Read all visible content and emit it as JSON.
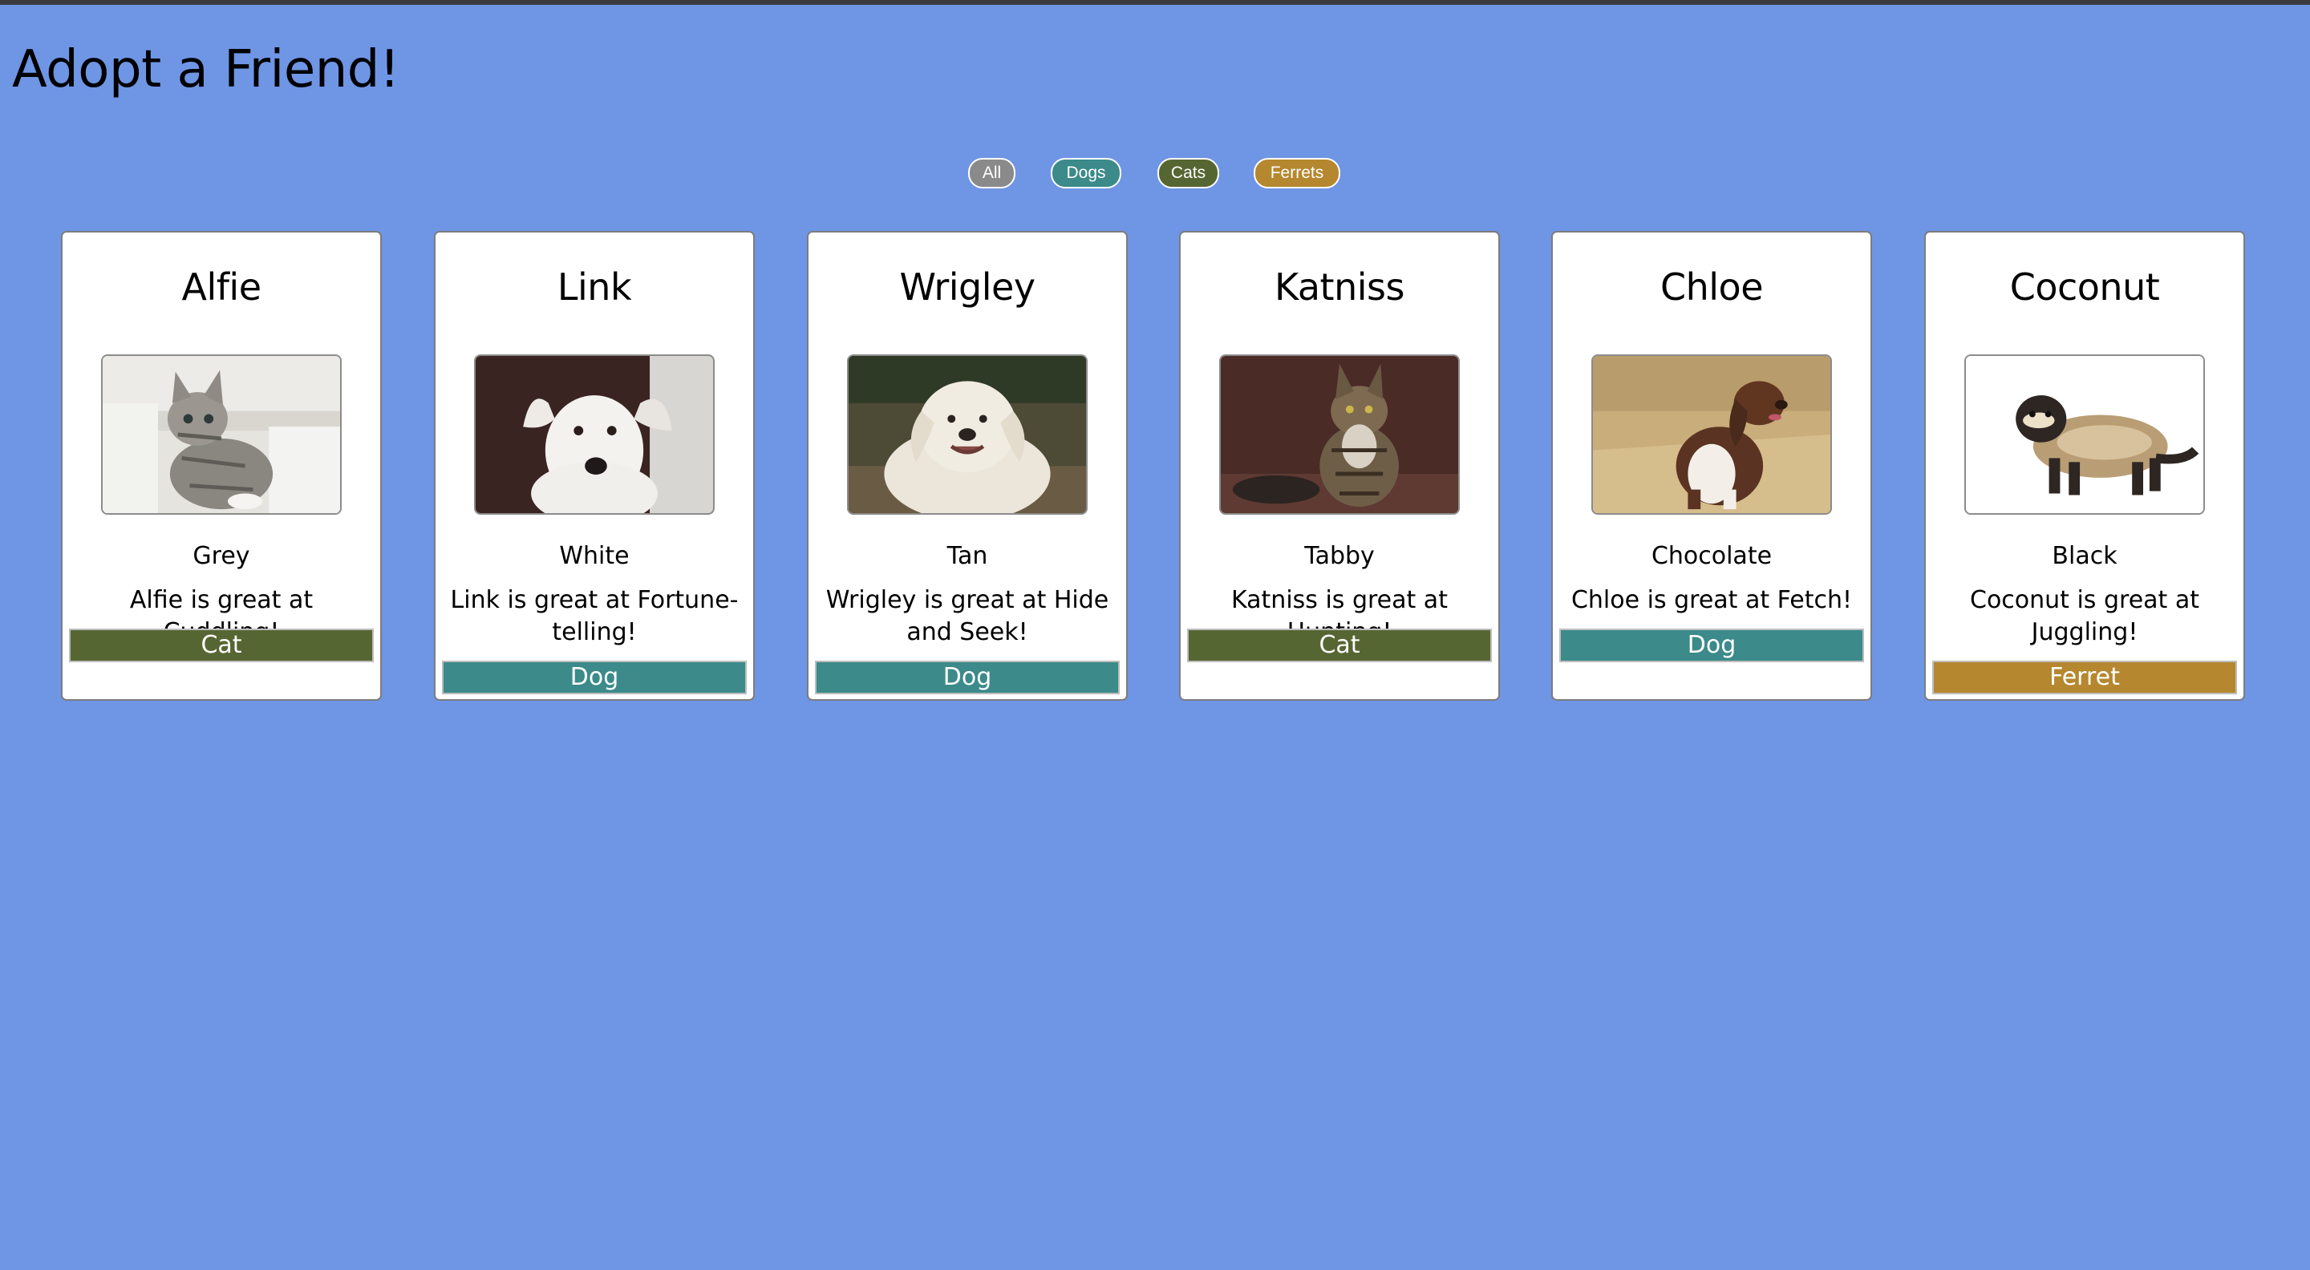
{
  "page": {
    "title": "Adopt a Friend!",
    "background_color": "#6f95e5"
  },
  "filters": [
    {
      "label": "All",
      "color": "#8a8a8a"
    },
    {
      "label": "Dogs",
      "color": "#3c8a8a"
    },
    {
      "label": "Cats",
      "color": "#566632"
    },
    {
      "label": "Ferrets",
      "color": "#b5872f"
    }
  ],
  "pets": [
    {
      "name": "Alfie",
      "color": "Grey",
      "description": "Alfie is great at Cuddling!",
      "type": "Cat",
      "type_color": "#566632",
      "photo": "grey-tabby-kitten-photo"
    },
    {
      "name": "Link",
      "color": "White",
      "description": "Link is great at Fortune-telling!",
      "type": "Dog",
      "type_color": "#3c8a8a",
      "photo": "white-terrier-dog-photo"
    },
    {
      "name": "Wrigley",
      "color": "Tan",
      "description": "Wrigley is great at Hide and Seek!",
      "type": "Dog",
      "type_color": "#3c8a8a",
      "photo": "cream-retriever-dog-photo"
    },
    {
      "name": "Katniss",
      "color": "Tabby",
      "description": "Katniss is great at Hunting!",
      "type": "Cat",
      "type_color": "#566632",
      "photo": "maine-coon-cat-photo"
    },
    {
      "name": "Chloe",
      "color": "Chocolate",
      "description": "Chloe is great at Fetch!",
      "type": "Dog",
      "type_color": "#3c8a8a",
      "photo": "brown-spaniel-dog-photo"
    },
    {
      "name": "Coconut",
      "color": "Black",
      "description": "Coconut is great at Juggling!",
      "type": "Ferret",
      "type_color": "#b5872f",
      "photo": "dark-ferret-photo"
    }
  ]
}
